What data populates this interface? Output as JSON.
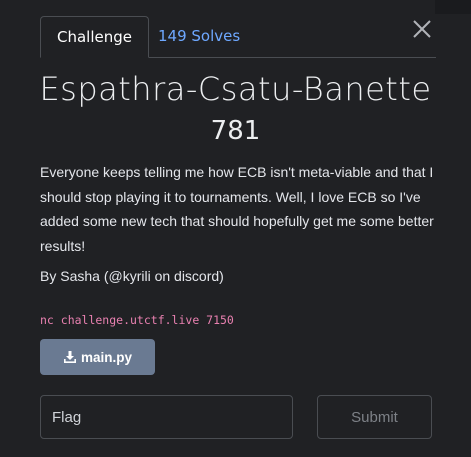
{
  "tabs": {
    "challenge_label": "Challenge",
    "solves_label": "149 Solves"
  },
  "challenge": {
    "name": "Espathra-Csatu-Banette",
    "points": "781",
    "description": "Everyone keeps telling me how ECB isn't meta-viable and that I should stop playing it to tournaments. Well, I love ECB so I've added some new tech that should hopefully get me some better results!",
    "author": "By Sasha (@kyrili on discord)",
    "connection": "nc challenge.utctf.live 7150"
  },
  "files": {
    "download_label": "main.py",
    "icon": "download-icon"
  },
  "form": {
    "flag_placeholder": "Flag",
    "flag_value": "",
    "submit_label": "Submit"
  },
  "icons": {
    "close": "close-icon"
  },
  "colors": {
    "background": "#202124",
    "link": "#6ea8ff",
    "code": "#e880b0",
    "file_button": "#6a7a92"
  }
}
